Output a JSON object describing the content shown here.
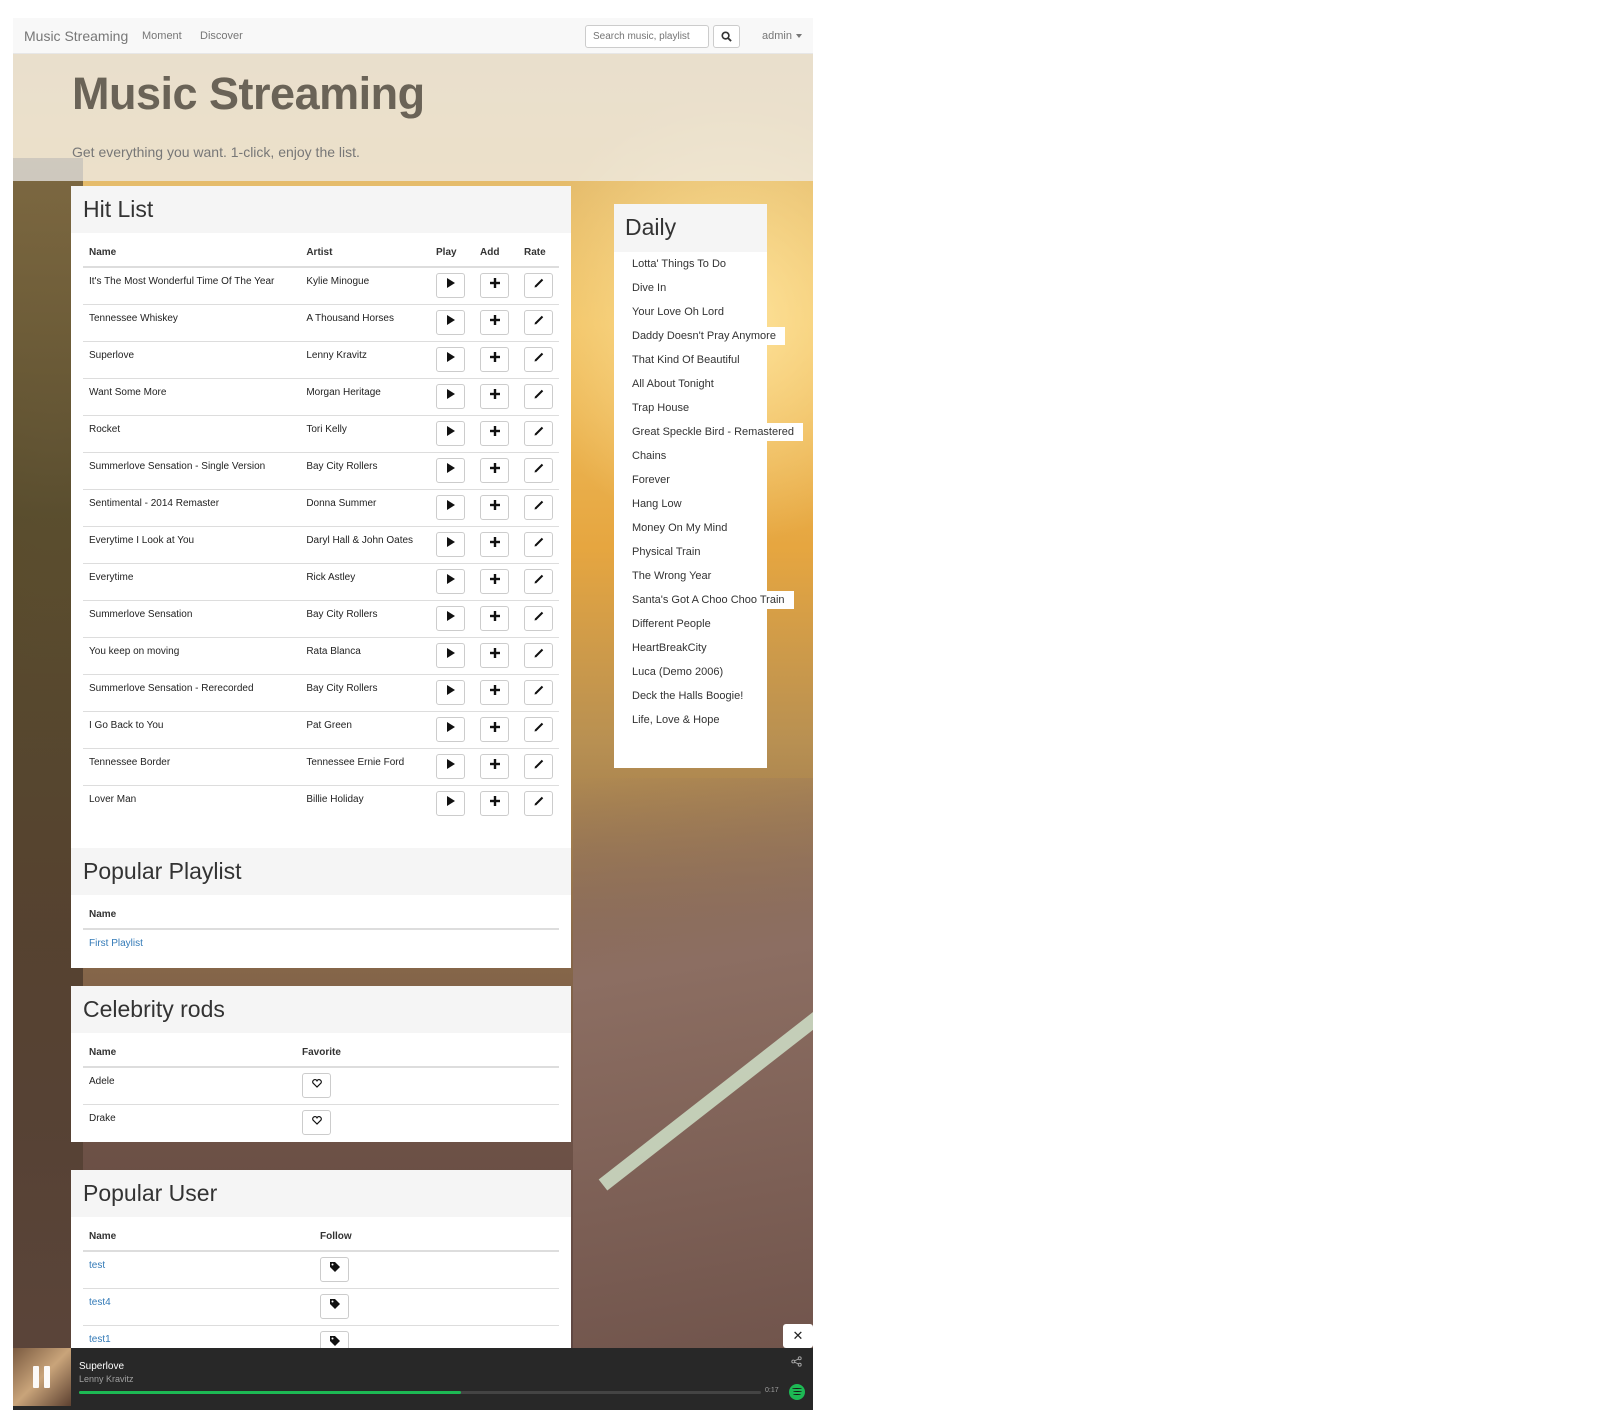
{
  "navbar": {
    "brand": "Music Streaming",
    "links": [
      "Moment",
      "Discover"
    ],
    "search_placeholder": "Search music, playlist",
    "user": "admin"
  },
  "jumbotron": {
    "title": "Music Streaming",
    "subtitle": "Get everything you want. 1-click, enjoy the list."
  },
  "hit_list": {
    "title": "Hit List",
    "columns": [
      "Name",
      "Artist",
      "Play",
      "Add",
      "Rate"
    ],
    "rows": [
      {
        "name": "It's The Most Wonderful Time Of The Year",
        "artist": "Kylie Minogue"
      },
      {
        "name": "Tennessee Whiskey",
        "artist": "A Thousand Horses"
      },
      {
        "name": "Superlove",
        "artist": "Lenny Kravitz"
      },
      {
        "name": "Want Some More",
        "artist": "Morgan Heritage"
      },
      {
        "name": "Rocket",
        "artist": "Tori Kelly"
      },
      {
        "name": "Summerlove Sensation - Single Version",
        "artist": "Bay City Rollers"
      },
      {
        "name": "Sentimental - 2014 Remaster",
        "artist": "Donna Summer"
      },
      {
        "name": "Everytime I Look at You",
        "artist": "Daryl Hall & John Oates"
      },
      {
        "name": "Everytime",
        "artist": "Rick Astley"
      },
      {
        "name": "Summerlove Sensation",
        "artist": "Bay City Rollers"
      },
      {
        "name": "You keep on moving",
        "artist": "Rata Blanca"
      },
      {
        "name": "Summerlove Sensation - Rerecorded",
        "artist": "Bay City Rollers"
      },
      {
        "name": "I Go Back to You",
        "artist": "Pat Green"
      },
      {
        "name": "Tennessee Border",
        "artist": "Tennessee Ernie Ford"
      },
      {
        "name": "Lover Man",
        "artist": "Billie Holiday"
      }
    ]
  },
  "popular_playlist": {
    "title": "Popular Playlist",
    "columns": [
      "Name"
    ],
    "rows": [
      "First Playlist"
    ]
  },
  "celebrity": {
    "title": "Celebrity rods",
    "columns": [
      "Name",
      "Favorite"
    ],
    "rows": [
      "Adele",
      "Drake"
    ]
  },
  "popular_user": {
    "title": "Popular User",
    "columns": [
      "Name",
      "Follow"
    ],
    "rows": [
      "test",
      "test4",
      "test1"
    ]
  },
  "daily": {
    "title": "Daily",
    "items": [
      "Lotta' Things To Do",
      "Dive In",
      "Your Love Oh Lord",
      "Daddy Doesn't Pray Anymore",
      "That Kind Of Beautiful",
      "All About Tonight",
      "Trap House",
      "Great Speckle Bird - Remastered",
      "Chains",
      "Forever",
      "Hang Low",
      "Money On My Mind",
      "Physical Train",
      "The Wrong Year",
      "Santa's Got A Choo Choo Train",
      "Different People",
      "HeartBreakCity",
      "Luca (Demo 2006)",
      "Deck the Halls Boogie!",
      "Life, Love & Hope"
    ]
  },
  "player": {
    "song": "Superlove",
    "artist": "Lenny Kravitz",
    "time": "0:17",
    "progress": 0.56
  },
  "icons": {
    "play": "play-icon",
    "add": "plus-icon",
    "rate": "pencil-icon",
    "favorite": "heart-icon",
    "follow": "tag-icon",
    "search": "search-icon",
    "close": "close-icon",
    "share": "share-icon",
    "pause": "pause-icon"
  },
  "colors": {
    "accent": "#1db954",
    "link": "#337ab7"
  }
}
